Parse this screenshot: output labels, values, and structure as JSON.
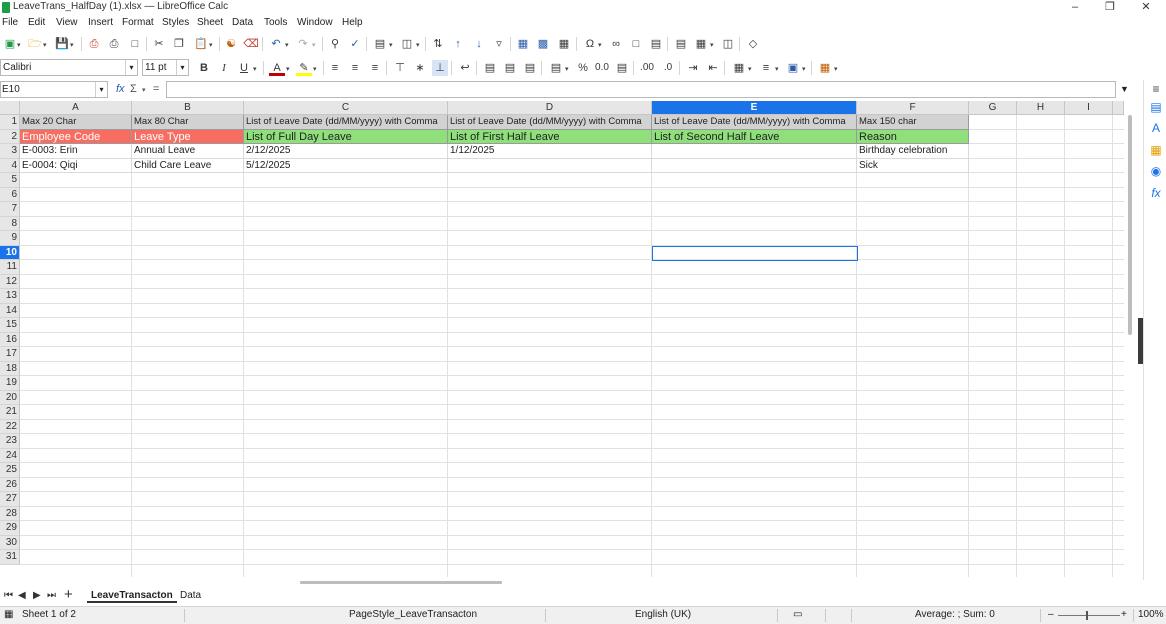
{
  "window": {
    "title": "LeaveTrans_HalfDay (1).xlsx — LibreOffice Calc"
  },
  "menu": [
    "File",
    "Edit",
    "View",
    "Insert",
    "Format",
    "Styles",
    "Sheet",
    "Data",
    "Tools",
    "Window",
    "Help"
  ],
  "format_bar": {
    "font_name": "Calibri",
    "font_size": "11 pt"
  },
  "formula_bar": {
    "cell_ref": "E10",
    "formula": ""
  },
  "columns": [
    "A",
    "B",
    "C",
    "D",
    "E",
    "F",
    "G",
    "H",
    "I"
  ],
  "active_column": "E",
  "active_row": "10",
  "rows": [
    "1",
    "2",
    "3",
    "4",
    "5",
    "6",
    "7",
    "8",
    "9",
    "10",
    "11",
    "12",
    "13",
    "14",
    "15",
    "16",
    "17",
    "18",
    "19",
    "20",
    "21",
    "22",
    "23",
    "24",
    "25",
    "26",
    "27",
    "28",
    "29",
    "30",
    "31"
  ],
  "sheet": {
    "row1": [
      "Max 20 Char",
      "Max 80 Char",
      "List of Leave Date (dd/MM/yyyy) with Comma",
      "List of Leave Date (dd/MM/yyyy) with Comma",
      "List of Leave Date (dd/MM/yyyy) with Comma",
      "Max 150 char"
    ],
    "row2": [
      "Employee Code",
      "Leave Type",
      "List of Full Day Leave",
      "List of First Half Leave",
      "List of Second Half Leave",
      "Reason"
    ],
    "row3": [
      "E-0003: Erin",
      "Annual Leave",
      "2/12/2025",
      "1/12/2025",
      "",
      "Birthday celebration"
    ],
    "row4": [
      "E-0004: Qiqi",
      "Child Care Leave",
      "5/12/2025",
      "",
      "",
      "Sick"
    ]
  },
  "colors": {
    "header_red": "#f86d62",
    "header_green": "#8fe07a",
    "accent": "#1a73e8"
  },
  "tabs": [
    "LeaveTransacton",
    "Data"
  ],
  "active_tab": "LeaveTransacton",
  "status": {
    "sheet": "Sheet 1 of 2",
    "page_style": "PageStyle_LeaveTransacton",
    "language": "English (UK)",
    "summary": "Average: ; Sum: 0",
    "zoom": "100%"
  }
}
